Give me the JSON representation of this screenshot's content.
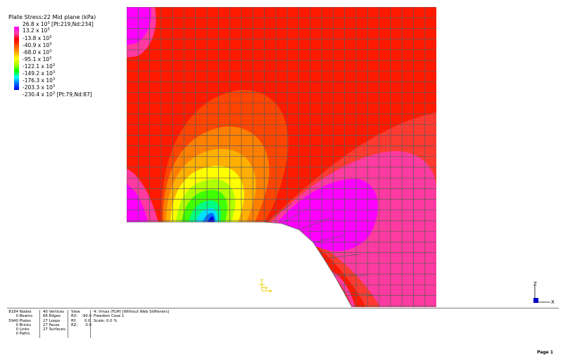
{
  "legend": {
    "title": "Plate Stress:22 Mid plane  (kPa)",
    "max_note": "[Pt:219,Nd:234]",
    "min_note": "[Pt:79,Nd:87]",
    "entries": [
      {
        "value": "26.8 x 10",
        "exp": "3",
        "color": "#ff00ff"
      },
      {
        "value": "13.2 x 10",
        "exp": "3",
        "color": "#ff3bb0"
      },
      {
        "value": "-13.8 x 10",
        "exp": "3",
        "color": "#ff0000"
      },
      {
        "value": "-40.9 x 10",
        "exp": "3",
        "color": "#ff4d00"
      },
      {
        "value": "-68.0 x 10",
        "exp": "3",
        "color": "#ffa000"
      },
      {
        "value": "-95.1 x 10",
        "exp": "3",
        "color": "#ffff00"
      },
      {
        "value": "-122.1 x 10",
        "exp": "3",
        "color": "#a8ff00"
      },
      {
        "value": "-149.2 x 10",
        "exp": "3",
        "color": "#00ff00"
      },
      {
        "value": "-176.3 x 10",
        "exp": "3",
        "color": "#00ffff"
      },
      {
        "value": "-203.3 x 10",
        "exp": "3",
        "color": "#0066ff"
      },
      {
        "value": "-230.4 x 10",
        "exp": "3",
        "color": "#0000ff"
      }
    ]
  },
  "axis": {
    "z_label": "Z",
    "x_label": "X"
  },
  "status": {
    "counts": [
      {
        "num": "8184",
        "label": "Nodes"
      },
      {
        "num": "0",
        "label": "Beams"
      },
      {
        "num": "5940",
        "label": "Plates"
      },
      {
        "num": "0",
        "label": "Bricks"
      },
      {
        "num": "0",
        "label": "Links"
      },
      {
        "num": "0",
        "label": "Paths"
      }
    ],
    "geometry": [
      {
        "num": "40",
        "label": "Vertices"
      },
      {
        "num": "66",
        "label": "Edges"
      },
      {
        "num": "27",
        "label": "Loops"
      },
      {
        "num": "27",
        "label": "Faces"
      },
      {
        "num": "27",
        "label": "Surfaces"
      }
    ],
    "view": {
      "title": "View",
      "rows": [
        {
          "label": "RX:",
          "value": "-90.0"
        },
        {
          "label": "RY:",
          "value": "0.0"
        },
        {
          "label": "RZ:",
          "value": "0.0"
        }
      ]
    },
    "model_info": [
      "4: Vmax (FLM) [Without Web Stiffeners]",
      "Freedom Case 1",
      "Scale:  0.0 %"
    ]
  },
  "page_number": "Page 1",
  "colors": {
    "background": "#ff1a00",
    "mesh_line": "#5a5a5a",
    "magenta": "#ff00ff",
    "pink": "#ff3399"
  }
}
